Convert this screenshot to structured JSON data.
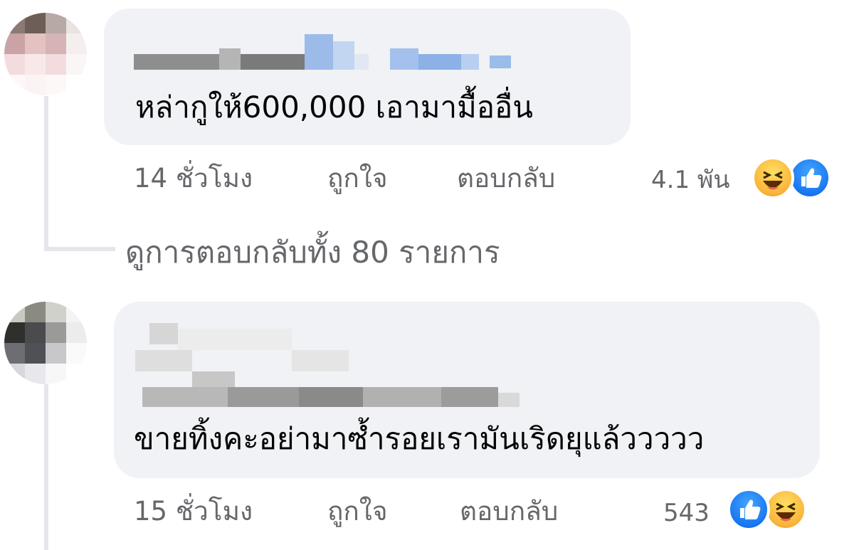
{
  "comments": [
    {
      "text": "หล่ากูให้600,000 เอามามื้ออื่น",
      "time": "14 ชั่วโมง",
      "like_label": "ถูกใจ",
      "reply_label": "ตอบกลับ",
      "reaction_count": "4.1 พัน",
      "reactions": [
        "haha-icon",
        "like-icon"
      ],
      "view_replies": "ดูการตอบกลับทั้ง 80 รายการ"
    },
    {
      "text": "ขายทิ้งคะอย่ามาซ้ำรอยเรามันเริดยุแล้ววววว",
      "time": "15 ชั่วโมง",
      "like_label": "ถูกใจ",
      "reply_label": "ตอบกลับ",
      "reaction_count": "543",
      "reactions": [
        "like-icon",
        "haha-icon"
      ]
    }
  ],
  "colors": {
    "bubble": "#f0f2f5",
    "meta_text": "#65676b",
    "like": "#1877f2",
    "haha": "#f9b43a"
  }
}
